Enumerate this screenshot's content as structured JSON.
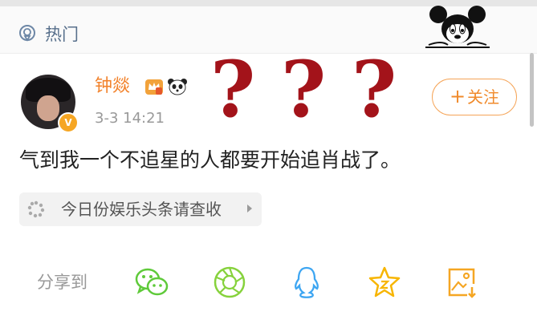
{
  "header": {
    "hot_label": "热门",
    "hot_icon": "location-pin-icon",
    "decoration_icon": "mickey-mouse-peeking-icon"
  },
  "post": {
    "username": "钟燚",
    "timestamp": "3-3 14:21",
    "follow_label": "关注",
    "follow_plus": "+",
    "content": "气到我一个不追星的人都要开始追肖战了。",
    "topic_chip": "今日份娱乐头条请查收",
    "verified_badge": "V",
    "badges": [
      "crown-badge-icon",
      "panda-badge-icon"
    ]
  },
  "overlay": {
    "question_marks": [
      "?",
      "?",
      "?"
    ],
    "color": "#a3131a"
  },
  "share": {
    "label": "分享到",
    "targets": [
      "wechat-icon",
      "moments-icon",
      "qq-icon",
      "favorite-icon",
      "save-image-icon"
    ]
  },
  "colors": {
    "accent": "#f2822b",
    "header_text": "#58708c",
    "wechat": "#5fca3a",
    "moments": "#86d23c",
    "qq": "#3ea6f2",
    "favorite": "#f7b500",
    "save": "#f5a623"
  }
}
